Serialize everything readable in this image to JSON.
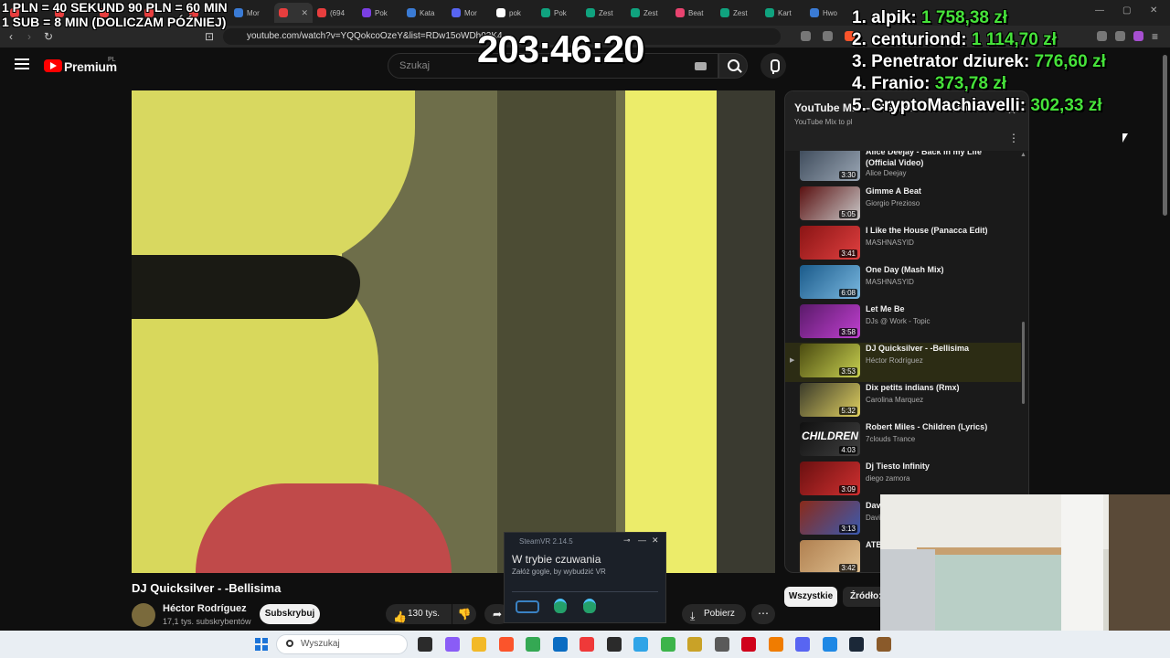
{
  "browser": {
    "tabs": [
      {
        "label": "",
        "color": "#e83e3e"
      },
      {
        "label": "",
        "color": "#e83e3e"
      },
      {
        "label": "",
        "color": "#e83e3e"
      },
      {
        "label": "",
        "color": "#e83e3e"
      },
      {
        "label": "",
        "color": "#e83e3e"
      },
      {
        "label": "Mor",
        "color": "#3a7bd5"
      },
      {
        "label": "",
        "color": "#e83e3e",
        "active": true
      },
      {
        "label": "(694",
        "color": "#e83e3e"
      },
      {
        "label": "Pok",
        "color": "#7b3fe4"
      },
      {
        "label": "Kata",
        "color": "#3a7bd5"
      },
      {
        "label": "Mor",
        "color": "#5865f2"
      },
      {
        "label": "pok",
        "color": "#ffffff"
      },
      {
        "label": "Pok",
        "color": "#10a37f"
      },
      {
        "label": "Zest",
        "color": "#10a37f"
      },
      {
        "label": "Zest",
        "color": "#10a37f"
      },
      {
        "label": "Beat",
        "color": "#e8436f"
      },
      {
        "label": "Zest",
        "color": "#10a37f"
      },
      {
        "label": "Kart",
        "color": "#10a37f"
      },
      {
        "label": "Hwo",
        "color": "#3a7bd5"
      }
    ],
    "tab_close": "✕",
    "url": "youtube.com/watch?v=YQQokcoOzeY&list=RDw15oWDh02K4"
  },
  "youtube": {
    "brand": "Premium",
    "country": "PL",
    "search_placeholder": "Szukaj"
  },
  "video": {
    "title": "DJ Quicksilver - -Bellisima",
    "channel": "Héctor Rodríguez",
    "subscribers": "17,1 tys. subskrybentów",
    "subscribe_label": "Subskrybuj",
    "likes": "130 tys.",
    "download_label": "Pobierz",
    "like_icon": "👍",
    "dislike_icon": "👎",
    "share_icon": "➦",
    "download_icon": "⤓",
    "more_icon": "⋯"
  },
  "playlist": {
    "title": "YouTube Mix – GIGI D'AGOSTINO -...",
    "subtitle": "YouTube Mix to pl",
    "close_icon": "✕",
    "kebab_icon": "⋮",
    "play_indicator": "▶",
    "scroll_up": "▲",
    "items": [
      {
        "title": "Alice Deejay - Back in my Life (Official Video)",
        "author": "Alice Deejay",
        "duration": "3:30",
        "colors": [
          "#3d4a5a",
          "#9aa6b4"
        ]
      },
      {
        "title": "Gimme A Beat",
        "author": "Giorgio Prezioso",
        "duration": "5:05",
        "colors": [
          "#5a1010",
          "#c8c8c8"
        ]
      },
      {
        "title": "I Like the House (Panacca Edit)",
        "author": "MASHNASYID",
        "duration": "3:41",
        "colors": [
          "#8a1414",
          "#e04040"
        ]
      },
      {
        "title": "One Day (Mash Mix)",
        "author": "MASHNASYID",
        "duration": "6:08",
        "colors": [
          "#1a5a8a",
          "#7ab8e0"
        ]
      },
      {
        "title": "Let Me Be",
        "author": "DJs @ Work - Topic",
        "duration": "3:58",
        "colors": [
          "#5a1a6a",
          "#c040d0"
        ]
      },
      {
        "title": "DJ Quicksilver - -Bellisima",
        "author": "Héctor Rodríguez",
        "duration": "3:53",
        "colors": [
          "#4a4a10",
          "#c8d050"
        ],
        "current": true
      },
      {
        "title": "Dix petits indians (Rmx)",
        "author": "Carolina Marquez",
        "duration": "5:32",
        "colors": [
          "#3a3a2a",
          "#e0d060"
        ]
      },
      {
        "title": "Robert Miles - Children (Lyrics)",
        "author": "7clouds Trance",
        "duration": "4:03",
        "colors": [
          "#101010",
          "#404040"
        ],
        "thumb_text": "CHILDREN"
      },
      {
        "title": "Dj Tiesto Infinity",
        "author": "diego zamora",
        "duration": "3:09",
        "colors": [
          "#6a1010",
          "#d03030"
        ]
      },
      {
        "title": "Dav Row",
        "author": "Davi",
        "duration": "3:13",
        "colors": [
          "#8a2a1a",
          "#3a5ab0"
        ]
      },
      {
        "title": "ATB New",
        "author": "",
        "duration": "3:42",
        "colors": [
          "#b08050",
          "#e0c090"
        ]
      }
    ]
  },
  "filters": {
    "all": "Wszystkie",
    "sources": "Źródło:"
  },
  "overlay": {
    "line1": "1 PLN = 40 SEKUND 90 PLN = 60 MIN",
    "line2": "1 SUB = 8 MIN (DOLICZAM PÓŹNIEJ)",
    "timer": "203:46:20",
    "donors": [
      {
        "name": "1. alpik:",
        "amount": "1 758,38 zł"
      },
      {
        "name": "2. centuriond:",
        "amount": "1 114,70 zł"
      },
      {
        "name": "3. Penetrator dziurek:",
        "amount": "776,60 zł"
      },
      {
        "name": "4. Franio:",
        "amount": "373,78 zł"
      },
      {
        "name": "5. CryptoMachiavelli:",
        "amount": "302,33 zł"
      }
    ],
    "donor_amount_color": "#46e23a"
  },
  "steamvr": {
    "app_title": "SteamVR 2.14.5",
    "status": "W trybie czuwania",
    "hint": "Załóż gogle, by wybudzić VR",
    "pin_icon": "⊸",
    "minimize_icon": "—",
    "close_icon": "✕"
  },
  "taskbar": {
    "search_placeholder": "Wyszukaj",
    "apps": [
      {
        "name": "task-view",
        "color": "#2b2b2b"
      },
      {
        "name": "copilot",
        "color": "#8a5cf6"
      },
      {
        "name": "file-explorer",
        "color": "#f2b928"
      },
      {
        "name": "brave",
        "color": "#fb542b"
      },
      {
        "name": "chrome",
        "color": "#34a853"
      },
      {
        "name": "store",
        "color": "#0a6cc2"
      },
      {
        "name": "vivaldi",
        "color": "#ef3939"
      },
      {
        "name": "obs",
        "color": "#2b2b2b"
      },
      {
        "name": "notepad",
        "color": "#2fa4e7"
      },
      {
        "name": "app-green",
        "color": "#3cb44a"
      },
      {
        "name": "winamp",
        "color": "#c9a227"
      },
      {
        "name": "calculator",
        "color": "#5a5a5a"
      },
      {
        "name": "app-red",
        "color": "#d0021b"
      },
      {
        "name": "app-orange",
        "color": "#f07c00"
      },
      {
        "name": "discord",
        "color": "#5865f2"
      },
      {
        "name": "app-blue",
        "color": "#1e88e5"
      },
      {
        "name": "steam",
        "color": "#1b2838"
      },
      {
        "name": "app-brown",
        "color": "#8a5a2a"
      }
    ]
  }
}
